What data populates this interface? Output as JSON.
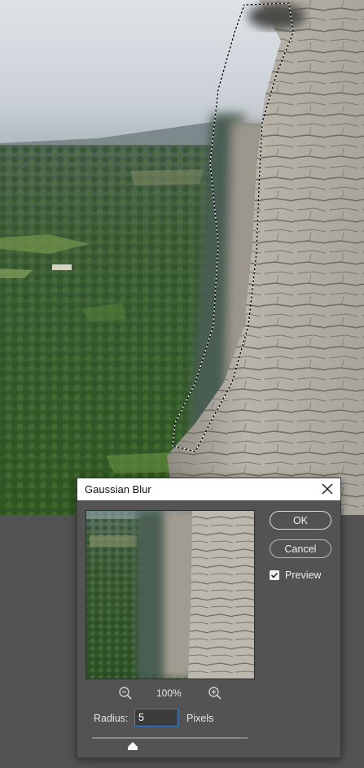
{
  "dialog": {
    "title": "Gaussian Blur",
    "ok_label": "OK",
    "cancel_label": "Cancel",
    "preview_label": "Preview",
    "preview_checked": true,
    "zoom_level": "100%",
    "radius_label": "Radius:",
    "radius_value": "5",
    "radius_units": "Pixels",
    "radius_slider_fraction": 0.26
  },
  "icons": {
    "close": "close-icon",
    "zoom_out": "zoom-out-icon",
    "zoom_in": "zoom-in-icon",
    "checkmark": "checkmark-icon"
  },
  "colors": {
    "workspace": "#535353",
    "dialog_bg": "#535353",
    "titlebar_bg": "#ffffff",
    "input_focus_border": "#3a7fcf"
  }
}
